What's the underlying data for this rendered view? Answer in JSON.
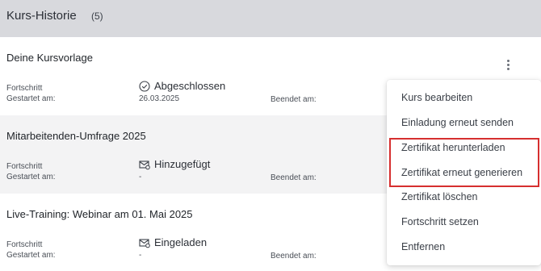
{
  "header": {
    "title": "Kurs-Historie",
    "count": "(5)"
  },
  "labels": {
    "progress": "Fortschritt",
    "started": "Gestartet am:",
    "ended": "Beendet am:"
  },
  "courses": [
    {
      "title": "Deine Kursvorlage",
      "status": "Abgeschlossen",
      "status_icon": "check-circle-icon",
      "started": "26.03.2025"
    },
    {
      "title": "Mitarbeitenden-Umfrage 2025",
      "status": "Hinzugefügt",
      "status_icon": "envelope-icon",
      "started": "-"
    },
    {
      "title": "Live-Training: Webinar am 01. Mai 2025",
      "status": "Eingeladen",
      "status_icon": "envelope-icon",
      "started": "-"
    }
  ],
  "menu": {
    "items": [
      {
        "label": "Kurs bearbeiten"
      },
      {
        "label": "Einladung erneut senden"
      },
      {
        "label": "Zertifikat herunterladen"
      },
      {
        "label": "Zertifikat erneut generieren"
      },
      {
        "label": "Zertifikat löschen"
      },
      {
        "label": "Fortschritt setzen"
      },
      {
        "label": "Entfernen"
      }
    ]
  },
  "colors": {
    "header_bg": "#d8d9dd",
    "alt_row_bg": "#f3f3f4",
    "highlight": "#d62f2f"
  }
}
